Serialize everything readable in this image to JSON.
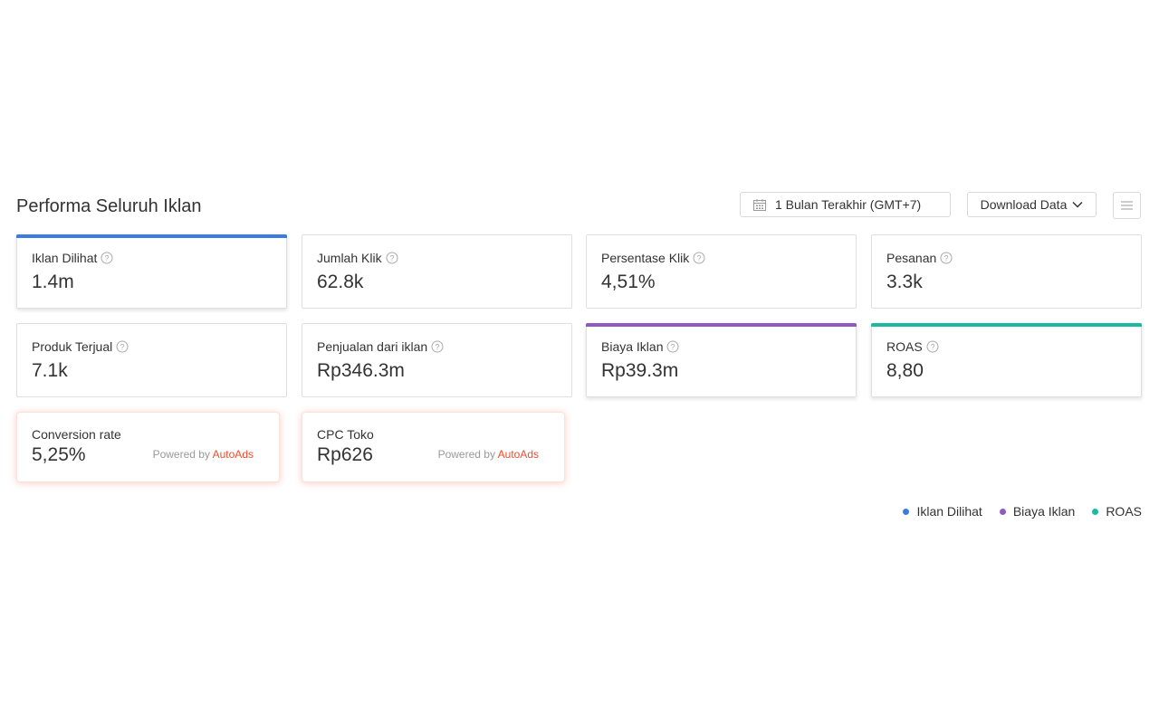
{
  "header": {
    "title": "Performa Seluruh Iklan",
    "date_range": "1 Bulan Terakhir (GMT+7)",
    "download_label": "Download Data"
  },
  "metrics": [
    {
      "label": "Iklan Dilihat",
      "value": "1.4m",
      "accent": "#3c7be0"
    },
    {
      "label": "Jumlah Klik",
      "value": "62.8k"
    },
    {
      "label": "Persentase Klik",
      "value": "4,51%"
    },
    {
      "label": "Pesanan",
      "value": "3.3k"
    },
    {
      "label": "Produk Terjual",
      "value": "7.1k"
    },
    {
      "label": "Penjualan dari iklan",
      "value": "Rp346.3m"
    },
    {
      "label": "Biaya Iklan",
      "value": "Rp39.3m",
      "accent": "#8f5bc1"
    },
    {
      "label": "ROAS",
      "value": "8,80",
      "accent": "#1bb8a4"
    }
  ],
  "autoads": [
    {
      "label": "Conversion rate",
      "value": "5,25%",
      "powered_prefix": "Powered by",
      "brand": "AutoAds"
    },
    {
      "label": "CPC Toko",
      "value": "Rp626",
      "powered_prefix": "Powered by",
      "brand": "AutoAds"
    }
  ],
  "legend": [
    {
      "label": "Iklan Dilihat",
      "color": "#3c7be0"
    },
    {
      "label": "Biaya Iklan",
      "color": "#8f5bc1"
    },
    {
      "label": "ROAS",
      "color": "#1bb8a4"
    }
  ],
  "colors": {
    "brand": "#ee4d2d",
    "text": "#333333",
    "border": "#e0e0e0"
  }
}
